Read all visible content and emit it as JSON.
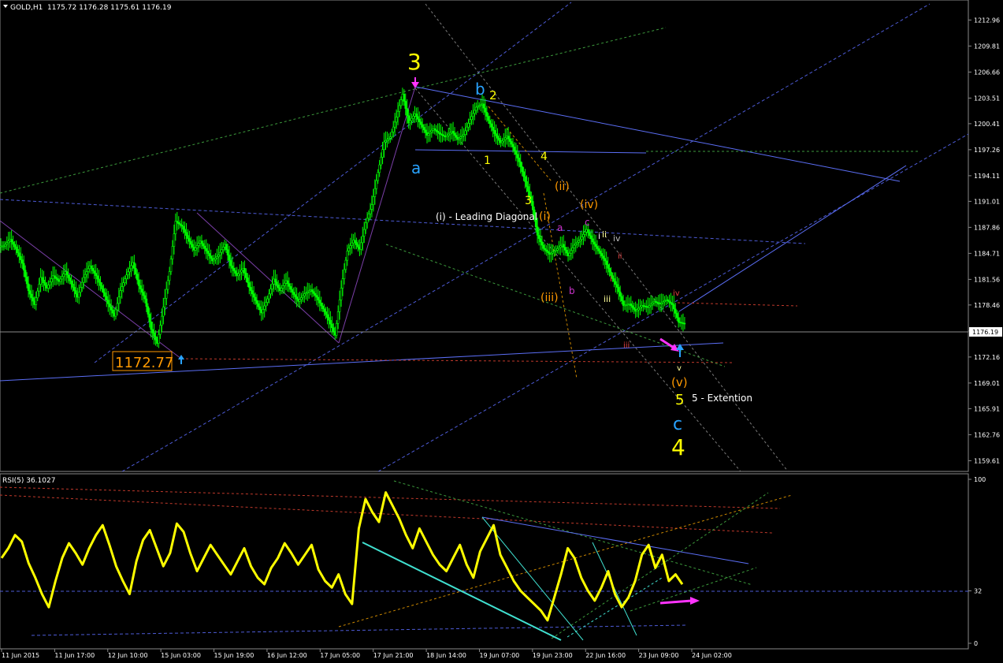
{
  "header": {
    "symbol_label": "GOLD,H1",
    "ohlc_text": "1175.72 1176.28 1175.61 1176.19",
    "current_price": "1176.19",
    "rsi_label": "RSI(5) 36.1027"
  },
  "chart_data": [
    {
      "type": "line",
      "title": "GOLD,H1",
      "price_ticks": [
        "1212.96",
        "1209.81",
        "1206.66",
        "1203.51",
        "1200.41",
        "1197.26",
        "1194.11",
        "1191.01",
        "1187.86",
        "1184.71",
        "1181.56",
        "1178.46",
        "1175.31",
        "1172.16",
        "1169.01",
        "1165.91",
        "1162.76",
        "1159.61"
      ],
      "time_ticks": [
        "11 Jun 2015",
        "11 Jun 17:00",
        "12 Jun 10:00",
        "15 Jun 03:00",
        "15 Jun 19:00",
        "16 Jun 12:00",
        "17 Jun 05:00",
        "17 Jun 21:00",
        "18 Jun 14:00",
        "19 Jun 07:00",
        "19 Jun 23:00",
        "22 Jun 16:00",
        "23 Jun 09:00",
        "24 Jun 02:00"
      ],
      "ylim": [
        1158.5,
        1215.0
      ],
      "current_price": 1176.19,
      "low_marker": "1172.77",
      "series": [
        {
          "values": [
            1185.6,
            1186.4,
            1185.2,
            1183.5,
            1180.2,
            1178.5,
            1181.8,
            1180.5,
            1182.0,
            1181.3,
            1182.5,
            1181.0,
            1179.4,
            1181.8,
            1183.2,
            1182.0,
            1180.4,
            1178.6,
            1177.1,
            1180.2,
            1182.1,
            1183.6,
            1180.8,
            1179.2,
            1175.5,
            1173.8,
            1178.2,
            1182.5,
            1188.6,
            1188.0,
            1186.5,
            1185.1,
            1186.2,
            1185.0,
            1183.8,
            1184.5,
            1185.8,
            1183.2,
            1182.0,
            1182.9,
            1180.6,
            1179.0,
            1177.5,
            1179.2,
            1181.6,
            1180.2,
            1181.4,
            1180.0,
            1178.9,
            1179.8,
            1180.3,
            1179.4,
            1178.0,
            1176.6,
            1174.8,
            1180.5,
            1185.0,
            1186.3,
            1185.2,
            1188.4,
            1190.6,
            1194.5,
            1198.2,
            1198.8,
            1201.2,
            1204.0,
            1200.5,
            1201.6,
            1200.3,
            1199.0,
            1199.8,
            1199.2,
            1198.8,
            1199.5,
            1198.5,
            1199.1,
            1200.9,
            1202.4,
            1202.8,
            1200.8,
            1199.2,
            1198.1,
            1198.9,
            1197.6,
            1195.8,
            1193.4,
            1191.0,
            1186.9,
            1185.3,
            1184.6,
            1185.1,
            1185.8,
            1184.4,
            1185.7,
            1186.4,
            1187.6,
            1186.1,
            1185.0,
            1183.8,
            1182.0,
            1180.6,
            1178.4,
            1178.6,
            1177.7,
            1178.4,
            1178.2,
            1178.9,
            1178.6,
            1179.1,
            1178.5,
            1176.4,
            1176.2
          ]
        },
        {
          "name": "RSI(5)",
          "values": [
            52,
            58,
            66,
            62,
            49,
            40,
            30,
            22,
            38,
            52,
            61,
            55,
            48,
            58,
            66,
            72,
            60,
            47,
            38,
            30,
            50,
            63,
            69,
            58,
            47,
            55,
            73,
            68,
            55,
            44,
            52,
            60,
            54,
            48,
            42,
            50,
            58,
            47,
            40,
            36,
            46,
            52,
            61,
            55,
            48,
            54,
            60,
            45,
            38,
            34,
            42,
            30,
            24,
            70,
            88,
            80,
            74,
            92,
            84,
            76,
            66,
            58,
            70,
            62,
            54,
            48,
            44,
            52,
            60,
            48,
            40,
            56,
            64,
            72,
            54,
            46,
            38,
            32,
            28,
            24,
            20,
            14,
            28,
            42,
            58,
            52,
            40,
            32,
            26,
            34,
            44,
            30,
            22,
            28,
            38,
            54,
            60,
            46,
            54,
            38,
            42,
            36
          ]
        }
      ]
    }
  ],
  "annotations": {
    "wave_3_top": "3",
    "wave_a": "a",
    "wave_b_blue": "b",
    "wave_2": "2",
    "wave_1": "1",
    "wave_4_small": "4",
    "wave_3_small": "3",
    "leading_diagonal": "(i) - Leading Diagonal",
    "wave_i_paren": "(i)",
    "wave_ii_paren": "(ii)",
    "wave_iii_paren": "(iii)",
    "wave_iv_paren": "(iv)",
    "wave_v_paren": "(v)",
    "sub_a": "a",
    "sub_b": "b",
    "sub_c": "c",
    "roman_i": "i",
    "roman_ii": "ii",
    "roman_iii_red": "iii",
    "roman_iii": "iii",
    "roman_iv": "iv",
    "roman_iv_red": "iv",
    "roman_v": "v",
    "roman_ii_red": "ii",
    "roman_iv_white": "iv",
    "wave_5": "5",
    "extension": "5 - Extention",
    "wave_c_blue": "c",
    "wave_4_big": "4"
  },
  "rsi_axis": {
    "ticks": [
      "100",
      "32",
      "0"
    ]
  },
  "colors": {
    "background": "#000000",
    "candles": "#00ff00",
    "rsi_line": "#ffff00",
    "wave_yellow": "#ffff00",
    "wave_blue": "#29a3ff",
    "wave_orange": "#ff9900",
    "wave_magenta": "#cc33cc"
  }
}
